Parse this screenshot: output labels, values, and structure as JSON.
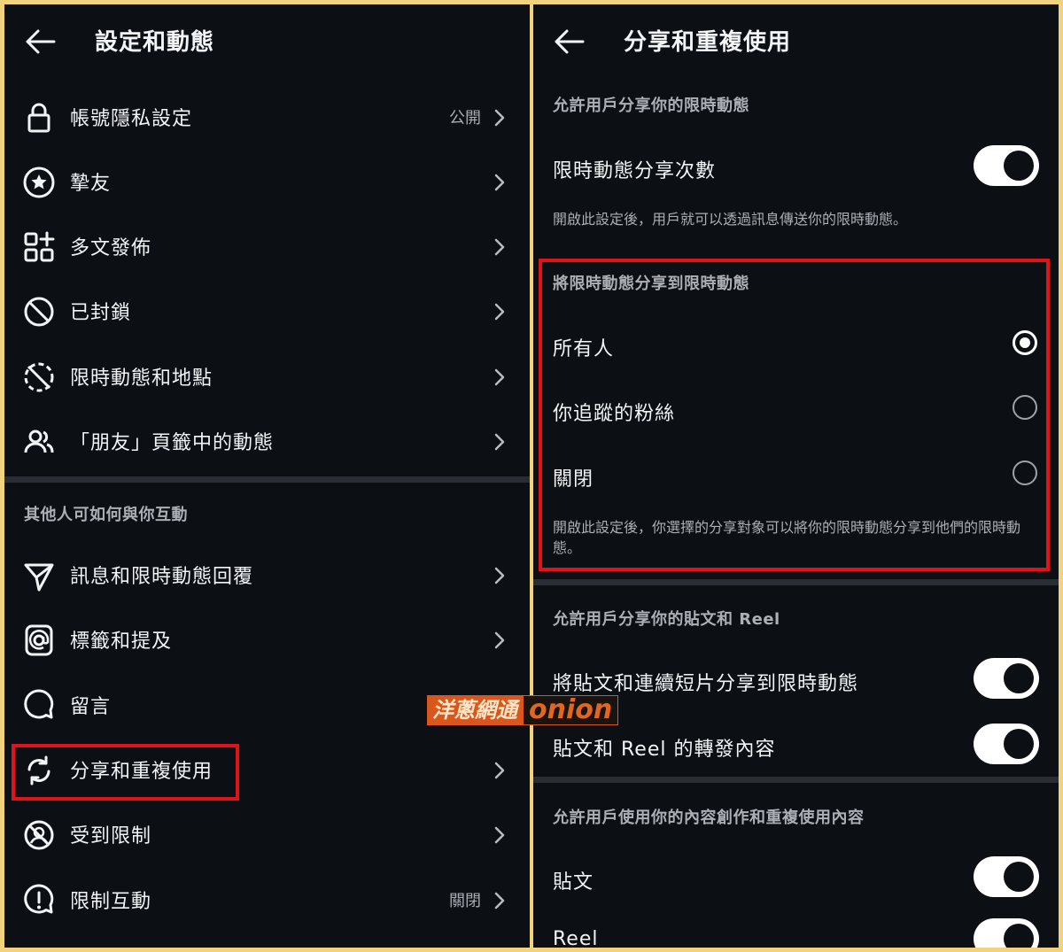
{
  "left": {
    "title": "設定和動態",
    "items": [
      {
        "label": "帳號隱私設定",
        "value": "公開",
        "icon": "lock-icon"
      },
      {
        "label": "摯友",
        "value": "",
        "icon": "star-circle-icon"
      },
      {
        "label": "多文發佈",
        "value": "",
        "icon": "grid-plus-icon"
      },
      {
        "label": "已封鎖",
        "value": "",
        "icon": "blocked-icon"
      },
      {
        "label": "限時動態和地點",
        "value": "",
        "icon": "story-off-icon"
      },
      {
        "label": "「朋友」頁籤中的動態",
        "value": "",
        "icon": "people-icon"
      }
    ],
    "section_title": "其他人可如何與你互動",
    "items2": [
      {
        "label": "訊息和限時動態回覆",
        "value": "",
        "icon": "messenger-icon"
      },
      {
        "label": "標籤和提及",
        "value": "",
        "icon": "at-sign-icon"
      },
      {
        "label": "留言",
        "value": "",
        "icon": "comment-icon"
      },
      {
        "label": "分享和重複使用",
        "value": "",
        "icon": "share-reuse-icon"
      },
      {
        "label": "受到限制",
        "value": "",
        "icon": "restricted-icon"
      },
      {
        "label": "限制互動",
        "value": "關閉",
        "icon": "alert-circle-icon"
      }
    ]
  },
  "right": {
    "title": "分享和重複使用",
    "sec1": {
      "title": "允許用戶分享你的限時動態",
      "toggle_label": "限時動態分享次數",
      "toggle_on": true,
      "note": "開啟此設定後，用戶就可以透過訊息傳送你的限時動態。"
    },
    "sec2": {
      "title": "將限時動態分享到限時動態",
      "options": [
        "所有人",
        "你追蹤的粉絲",
        "關閉"
      ],
      "selected": 0,
      "note": "開啟此設定後，你選擇的分享對象可以將你的限時動態分享到他們的限時動態。"
    },
    "sec3": {
      "title": "允許用戶分享你的貼文和 Reel",
      "items": [
        {
          "label": "將貼文和連續短片分享到限時動態",
          "on": true
        },
        {
          "label": "貼文和 Reel 的轉發內容",
          "on": true
        }
      ]
    },
    "sec4": {
      "title": "允許用戶使用你的內容創作和重複使用內容",
      "items": [
        {
          "label": "貼文",
          "on": true
        },
        {
          "label": "Reel",
          "on": true
        }
      ]
    }
  },
  "watermark": {
    "text_cn": "洋蔥網通",
    "text_en": "onion"
  },
  "colors": {
    "highlight": "#e0121b",
    "background": "#0c0f14",
    "frame": "#f3d27e"
  }
}
